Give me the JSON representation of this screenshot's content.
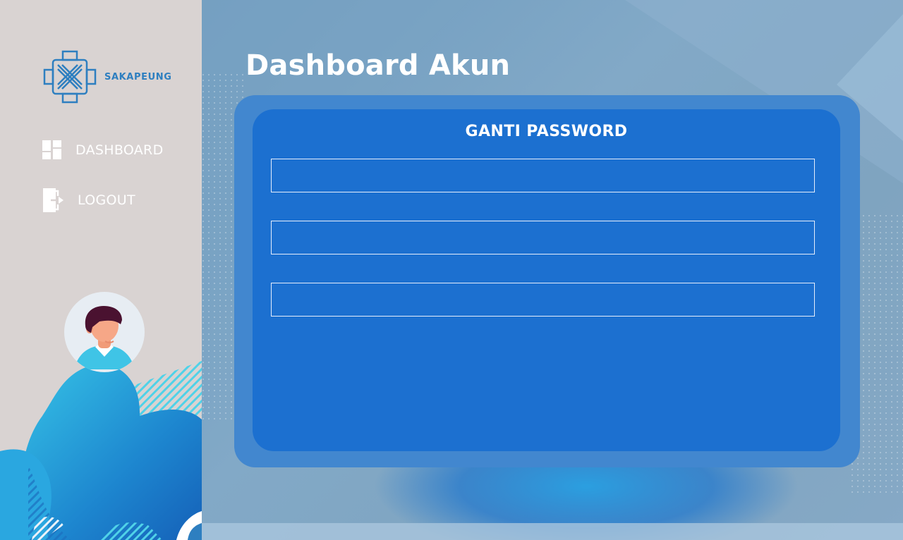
{
  "brand": {
    "name": "SAKAPEUNG",
    "logo_icon": "sakapeung-logo-icon",
    "color": "#2e7fc0"
  },
  "sidebar": {
    "background": "#d9d3d2",
    "items": [
      {
        "label": "DASHBOARD",
        "icon": "dashboard-grid-icon"
      },
      {
        "label": "LOGOUT",
        "icon": "logout-door-icon"
      }
    ],
    "avatar": "user-avatar"
  },
  "page": {
    "title": "Dashboard Akun"
  },
  "card": {
    "title": "GANTI PASSWORD",
    "fields": [
      {
        "value": "",
        "placeholder": ""
      },
      {
        "value": "",
        "placeholder": ""
      },
      {
        "value": "",
        "placeholder": ""
      }
    ],
    "outer_color": "#4287cf",
    "inner_color": "#1c70d0"
  }
}
